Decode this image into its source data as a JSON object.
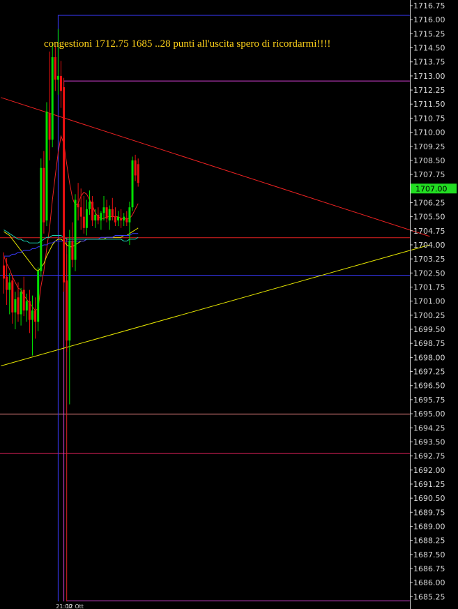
{
  "chart_data": {
    "type": "candlestick",
    "annotation": "congestioni 1712.75   1685 ..28 punti all'uscita spero di ricordarmi!!!!",
    "ylim": [
      1685.0,
      1717.2
    ],
    "y_ticks": [
      1716.75,
      1716.0,
      1715.25,
      1714.5,
      1713.75,
      1713.0,
      1712.25,
      1711.5,
      1710.75,
      1710.0,
      1709.25,
      1708.5,
      1707.75,
      1706.25,
      1705.5,
      1704.75,
      1704.0,
      1703.25,
      1702.5,
      1701.75,
      1701.0,
      1700.25,
      1699.5,
      1698.75,
      1698.0,
      1697.25,
      1696.5,
      1695.75,
      1695.0,
      1694.25,
      1693.5,
      1692.75,
      1692.0,
      1691.25,
      1690.5,
      1689.75,
      1689.0,
      1688.25,
      1687.5,
      1686.75,
      1686.0,
      1685.25
    ],
    "last_price": {
      "value": 1707.0,
      "label": "1707.00",
      "color": "#22dd22"
    },
    "x_labels": [
      "21:00",
      "12 Ott"
    ],
    "colors": {
      "up": "#00e000",
      "down": "#ee1111",
      "background": "#000000",
      "text": "#d8d8d8"
    },
    "horizontal_levels": [
      {
        "price": 1716.25,
        "color": "#3a3aff",
        "from": 19
      },
      {
        "price": 1712.75,
        "color": "#d040d0",
        "from": 21
      },
      {
        "price": 1704.4,
        "color": "#e02020",
        "from": 0
      },
      {
        "price": 1702.4,
        "color": "#3a3aff",
        "from": 0
      },
      {
        "price": 1695.0,
        "color": "#ff9090",
        "from": 0
      },
      {
        "price": 1692.9,
        "color": "#e0205a",
        "from": 0
      },
      {
        "price": 1685.05,
        "color": "#d040d0",
        "from": 22
      }
    ],
    "vertical_levels": [
      {
        "index": 19,
        "from": 1716.25,
        "to": 1685.0,
        "color": "#3a3aff"
      },
      {
        "index": 21,
        "from": 1712.75,
        "to": 1685.0,
        "color": "#d040d0"
      },
      {
        "index": 22,
        "from": 1704.4,
        "to": 1685.0,
        "color": "#e02020"
      }
    ],
    "trendlines": [
      {
        "color": "#ee2222",
        "p1": [
          -1,
          1711.85
        ],
        "p2": [
          149,
          1704.45
        ]
      },
      {
        "color": "#e6e600",
        "p1": [
          -1,
          1697.55
        ],
        "p2": [
          149,
          1704.0
        ]
      }
    ],
    "candles": [
      {
        "o": 1702.9,
        "h": 1703.6,
        "l": 1701.4,
        "c": 1702.2
      },
      {
        "o": 1702.3,
        "h": 1703.3,
        "l": 1700.8,
        "c": 1701.6
      },
      {
        "o": 1701.6,
        "h": 1702.5,
        "l": 1700.3,
        "c": 1702.0
      },
      {
        "o": 1702.1,
        "h": 1702.4,
        "l": 1699.8,
        "c": 1700.4
      },
      {
        "o": 1700.4,
        "h": 1701.5,
        "l": 1699.5,
        "c": 1701.1
      },
      {
        "o": 1701.2,
        "h": 1702.0,
        "l": 1699.9,
        "c": 1700.3
      },
      {
        "o": 1700.3,
        "h": 1701.7,
        "l": 1699.7,
        "c": 1701.5
      },
      {
        "o": 1701.6,
        "h": 1702.3,
        "l": 1700.2,
        "c": 1700.5
      },
      {
        "o": 1700.5,
        "h": 1701.4,
        "l": 1699.9,
        "c": 1701.0
      },
      {
        "o": 1701.0,
        "h": 1701.6,
        "l": 1699.3,
        "c": 1700.0
      },
      {
        "o": 1700.0,
        "h": 1701.3,
        "l": 1698.1,
        "c": 1700.5
      },
      {
        "o": 1700.5,
        "h": 1701.2,
        "l": 1699.0,
        "c": 1699.9
      },
      {
        "o": 1699.9,
        "h": 1702.8,
        "l": 1699.4,
        "c": 1702.6
      },
      {
        "o": 1702.6,
        "h": 1708.6,
        "l": 1702.3,
        "c": 1708.1
      },
      {
        "o": 1708.1,
        "h": 1709.0,
        "l": 1704.6,
        "c": 1705.2
      },
      {
        "o": 1705.3,
        "h": 1711.6,
        "l": 1705.0,
        "c": 1711.1
      },
      {
        "o": 1711.0,
        "h": 1714.3,
        "l": 1708.5,
        "c": 1709.6
      },
      {
        "o": 1709.6,
        "h": 1714.8,
        "l": 1709.2,
        "c": 1714.0
      },
      {
        "o": 1714.0,
        "h": 1714.6,
        "l": 1712.2,
        "c": 1712.8
      },
      {
        "o": 1712.8,
        "h": 1715.5,
        "l": 1712.0,
        "c": 1713.0
      },
      {
        "o": 1713.0,
        "h": 1713.8,
        "l": 1711.3,
        "c": 1712.2
      },
      {
        "o": 1712.4,
        "h": 1712.9,
        "l": 1701.5,
        "c": 1702.0
      },
      {
        "o": 1702.1,
        "h": 1703.5,
        "l": 1698.3,
        "c": 1698.9
      },
      {
        "o": 1698.9,
        "h": 1704.8,
        "l": 1695.5,
        "c": 1704.2
      },
      {
        "o": 1704.2,
        "h": 1705.2,
        "l": 1702.8,
        "c": 1703.2
      },
      {
        "o": 1703.2,
        "h": 1706.7,
        "l": 1702.6,
        "c": 1706.4
      },
      {
        "o": 1706.2,
        "h": 1707.3,
        "l": 1705.3,
        "c": 1706.0
      },
      {
        "o": 1706.0,
        "h": 1707.0,
        "l": 1704.8,
        "c": 1705.5
      },
      {
        "o": 1705.5,
        "h": 1706.6,
        "l": 1704.6,
        "c": 1704.9
      },
      {
        "o": 1704.9,
        "h": 1706.4,
        "l": 1704.5,
        "c": 1705.9
      },
      {
        "o": 1705.9,
        "h": 1706.9,
        "l": 1705.6,
        "c": 1706.3
      },
      {
        "o": 1706.3,
        "h": 1706.6,
        "l": 1705.0,
        "c": 1705.3
      },
      {
        "o": 1705.3,
        "h": 1705.9,
        "l": 1704.9,
        "c": 1705.6
      },
      {
        "o": 1705.6,
        "h": 1706.0,
        "l": 1705.1,
        "c": 1705.3
      },
      {
        "o": 1705.3,
        "h": 1705.8,
        "l": 1704.8,
        "c": 1705.7
      },
      {
        "o": 1705.7,
        "h": 1706.6,
        "l": 1705.3,
        "c": 1706.0
      },
      {
        "o": 1706.0,
        "h": 1706.4,
        "l": 1705.2,
        "c": 1705.4
      },
      {
        "o": 1705.3,
        "h": 1706.1,
        "l": 1704.8,
        "c": 1705.9
      },
      {
        "o": 1705.9,
        "h": 1706.5,
        "l": 1705.3,
        "c": 1705.5
      },
      {
        "o": 1705.5,
        "h": 1706.0,
        "l": 1705.0,
        "c": 1705.2
      },
      {
        "o": 1705.3,
        "h": 1705.8,
        "l": 1705.0,
        "c": 1705.5
      },
      {
        "o": 1705.4,
        "h": 1705.9,
        "l": 1704.9,
        "c": 1705.3
      },
      {
        "o": 1705.3,
        "h": 1705.7,
        "l": 1705.0,
        "c": 1705.5
      },
      {
        "o": 1705.4,
        "h": 1705.8,
        "l": 1705.0,
        "c": 1705.2
      },
      {
        "o": 1705.2,
        "h": 1706.3,
        "l": 1704.0,
        "c": 1706.0
      },
      {
        "o": 1706.0,
        "h": 1708.7,
        "l": 1705.8,
        "c": 1708.5
      },
      {
        "o": 1708.5,
        "h": 1708.8,
        "l": 1707.4,
        "c": 1707.7
      },
      {
        "o": 1708.3,
        "h": 1708.6,
        "l": 1707.1,
        "c": 1707.3
      }
    ],
    "moving_averages": [
      {
        "color": "#ee2222",
        "from": 0,
        "values": [
          1703.4,
          1703.0,
          1702.7,
          1702.3,
          1702.0,
          1701.7,
          1701.6,
          1701.3,
          1701.1,
          1700.9,
          1700.7,
          1700.5,
          1700.6,
          1701.8,
          1702.6,
          1703.8,
          1704.9,
          1706.4,
          1707.7,
          1708.9,
          1709.8,
          1709.4,
          1708.3,
          1707.3,
          1706.5,
          1706.1,
          1706.2,
          1706.6,
          1706.8,
          1706.7,
          1706.4,
          1706.1,
          1705.7,
          1705.5,
          1705.4,
          1705.4,
          1705.5,
          1705.5,
          1705.5,
          1705.5,
          1705.5,
          1705.4,
          1705.4,
          1705.4,
          1705.4,
          1705.6,
          1705.9,
          1706.2
        ]
      },
      {
        "color": "#e6e600",
        "from": 0,
        "values": [
          1704.7,
          1704.6,
          1704.5,
          1704.3,
          1704.1,
          1703.9,
          1703.7,
          1703.5,
          1703.3,
          1703.1,
          1702.9,
          1702.7,
          1702.6,
          1702.8,
          1703.0,
          1703.4,
          1703.7,
          1704.0,
          1704.2,
          1704.3,
          1704.3,
          1704.2,
          1704.0,
          1703.9,
          1703.9,
          1704.0,
          1704.1,
          1704.2,
          1704.2,
          1704.3,
          1704.3,
          1704.3,
          1704.3,
          1704.3,
          1704.3,
          1704.3,
          1704.4,
          1704.4,
          1704.4,
          1704.4,
          1704.4,
          1704.4,
          1704.5,
          1704.5,
          1704.6,
          1704.7,
          1704.8,
          1704.9
        ]
      },
      {
        "color": "#3b3bff",
        "from": 0,
        "values": [
          1703.4,
          1703.4,
          1703.4,
          1703.5,
          1703.5,
          1703.6,
          1703.6,
          1703.7,
          1703.7,
          1703.7,
          1703.8,
          1703.8,
          1703.9,
          1703.9,
          1704.0,
          1704.0,
          1704.1,
          1704.1,
          1704.2,
          1704.2,
          1704.2,
          1704.2,
          1704.2,
          1704.2,
          1704.2,
          1704.2,
          1704.2,
          1704.2,
          1704.2,
          1704.3,
          1704.3,
          1704.3,
          1704.3,
          1704.3,
          1704.4,
          1704.4,
          1704.4,
          1704.4,
          1704.4,
          1704.5,
          1704.5,
          1704.5,
          1704.5,
          1704.5,
          1704.5,
          1704.6,
          1704.6,
          1704.6
        ]
      },
      {
        "color": "#19d0b0",
        "from": 0,
        "values": [
          1704.8,
          1704.7,
          1704.6,
          1704.5,
          1704.4,
          1704.3,
          1704.3,
          1704.2,
          1704.2,
          1704.1,
          1704.1,
          1704.1,
          1704.1,
          1704.2,
          1704.3,
          1704.4,
          1704.4,
          1704.5,
          1704.5,
          1704.5,
          1704.5,
          1704.4,
          1704.3,
          1704.3,
          1704.3,
          1704.3,
          1704.3,
          1704.3,
          1704.3,
          1704.3,
          1704.3,
          1704.3,
          1704.3,
          1704.3,
          1704.3,
          1704.3,
          1704.3,
          1704.3,
          1704.3,
          1704.3,
          1704.3,
          1704.3,
          1704.2,
          1704.2,
          1704.3,
          1704.3,
          1704.3,
          1704.4
        ]
      }
    ]
  }
}
